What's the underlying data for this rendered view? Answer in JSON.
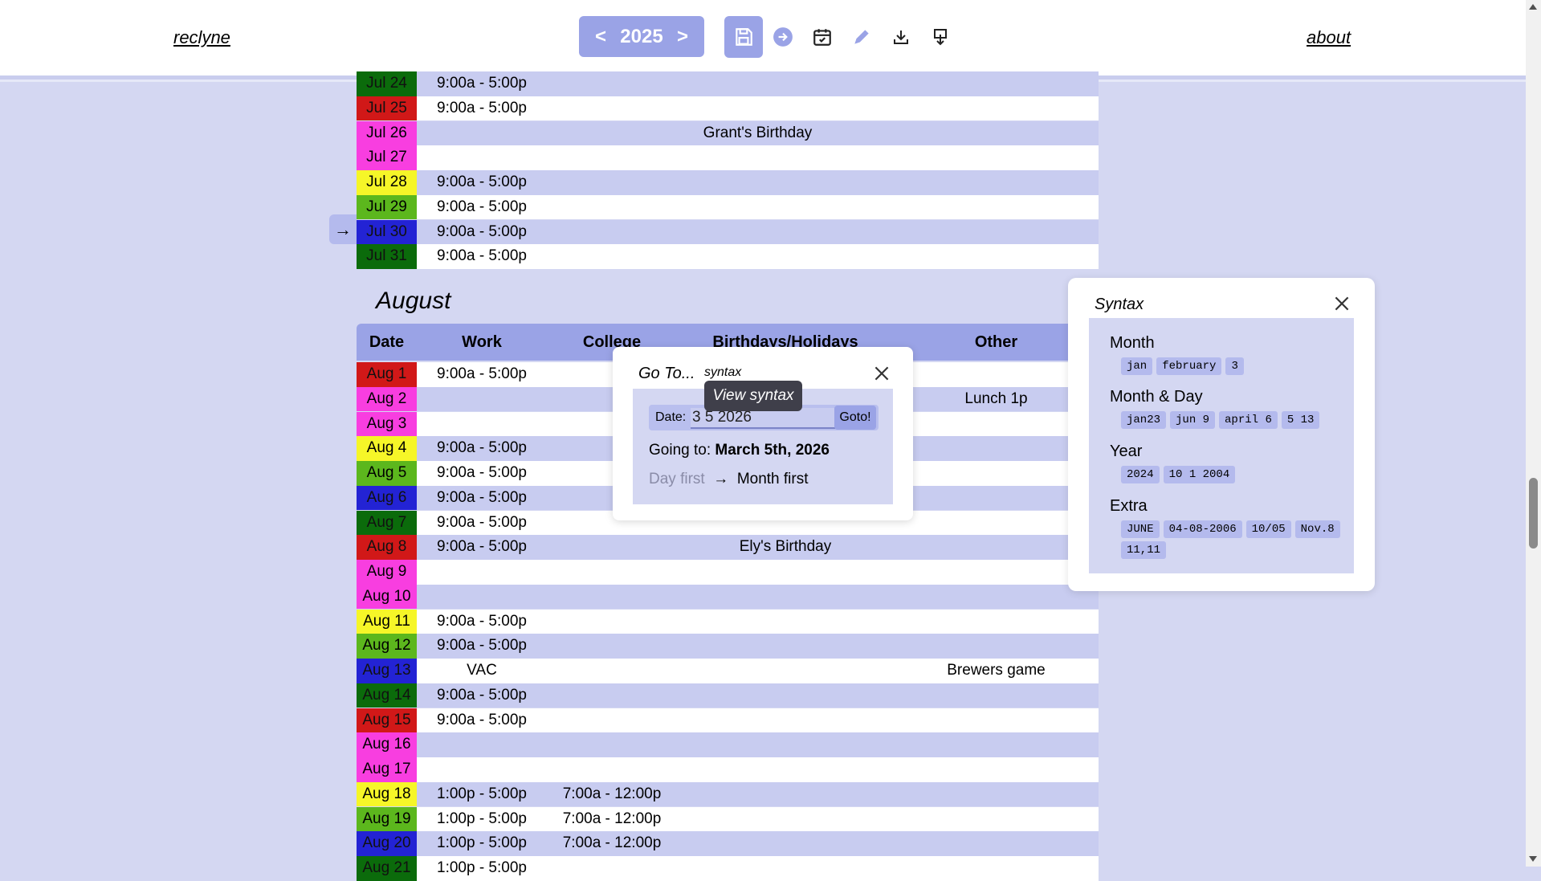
{
  "header": {
    "brand": "reclyne",
    "year": "2025",
    "prev_label": "<",
    "next_label": ">",
    "about": "about",
    "toolbar_icons": [
      "save-icon",
      "goto-icon",
      "calendar-check-icon",
      "pencil-icon",
      "download-icon",
      "export-icon"
    ]
  },
  "july_rows": [
    {
      "date": "Jul 24",
      "color": "#0b6b0b",
      "work": "9:00a - 5:00p",
      "college": "",
      "bday": "",
      "other": ""
    },
    {
      "date": "Jul 25",
      "color": "#d11818",
      "work": "9:00a - 5:00p",
      "college": "",
      "bday": "",
      "other": ""
    },
    {
      "date": "Jul 26",
      "color": "#f83ee0",
      "work": "",
      "college": "",
      "bday": "Grant's Birthday",
      "other": ""
    },
    {
      "date": "Jul 27",
      "color": "#f83ee0",
      "work": "",
      "college": "",
      "bday": "",
      "other": ""
    },
    {
      "date": "Jul 28",
      "color": "#f6f628",
      "work": "9:00a - 5:00p",
      "college": "",
      "bday": "",
      "other": ""
    },
    {
      "date": "Jul 29",
      "color": "#5cb71d",
      "work": "9:00a - 5:00p",
      "college": "",
      "bday": "",
      "other": ""
    },
    {
      "date": "Jul 30",
      "color": "#2323d4",
      "work": "9:00a - 5:00p",
      "college": "",
      "bday": "",
      "other": ""
    },
    {
      "date": "Jul 31",
      "color": "#0b6b0b",
      "work": "9:00a - 5:00p",
      "college": "",
      "bday": "",
      "other": ""
    }
  ],
  "today_arrow": "→",
  "month_title": "August",
  "columns": [
    "Date",
    "Work",
    "College",
    "Birthdays/Holidays",
    "Other"
  ],
  "august_rows": [
    {
      "date": "Aug 1",
      "color": "#d11818",
      "work": "9:00a - 5:00p",
      "college": "",
      "bday": "",
      "other": ""
    },
    {
      "date": "Aug 2",
      "color": "#f83ee0",
      "work": "",
      "college": "",
      "bday": "",
      "other": "Lunch 1p"
    },
    {
      "date": "Aug 3",
      "color": "#f83ee0",
      "work": "",
      "college": "",
      "bday": "",
      "other": ""
    },
    {
      "date": "Aug 4",
      "color": "#f6f628",
      "work": "9:00a - 5:00p",
      "college": "",
      "bday": "",
      "other": ""
    },
    {
      "date": "Aug 5",
      "color": "#5cb71d",
      "work": "9:00a - 5:00p",
      "college": "",
      "bday": "",
      "other": ""
    },
    {
      "date": "Aug 6",
      "color": "#2323d4",
      "work": "9:00a - 5:00p",
      "college": "",
      "bday": "",
      "other": ""
    },
    {
      "date": "Aug 7",
      "color": "#0b6b0b",
      "work": "9:00a - 5:00p",
      "college": "",
      "bday": "",
      "other": ""
    },
    {
      "date": "Aug 8",
      "color": "#d11818",
      "work": "9:00a - 5:00p",
      "college": "",
      "bday": "Ely's Birthday",
      "other": ""
    },
    {
      "date": "Aug 9",
      "color": "#f83ee0",
      "work": "",
      "college": "",
      "bday": "",
      "other": ""
    },
    {
      "date": "Aug 10",
      "color": "#f83ee0",
      "work": "",
      "college": "",
      "bday": "",
      "other": ""
    },
    {
      "date": "Aug 11",
      "color": "#f6f628",
      "work": "9:00a - 5:00p",
      "college": "",
      "bday": "",
      "other": ""
    },
    {
      "date": "Aug 12",
      "color": "#5cb71d",
      "work": "9:00a - 5:00p",
      "college": "",
      "bday": "",
      "other": ""
    },
    {
      "date": "Aug 13",
      "color": "#2323d4",
      "work": "VAC",
      "college": "",
      "bday": "",
      "other": "Brewers game"
    },
    {
      "date": "Aug 14",
      "color": "#0b6b0b",
      "work": "9:00a - 5:00p",
      "college": "",
      "bday": "",
      "other": ""
    },
    {
      "date": "Aug 15",
      "color": "#d11818",
      "work": "9:00a - 5:00p",
      "college": "",
      "bday": "",
      "other": ""
    },
    {
      "date": "Aug 16",
      "color": "#f83ee0",
      "work": "",
      "college": "",
      "bday": "",
      "other": ""
    },
    {
      "date": "Aug 17",
      "color": "#f83ee0",
      "work": "",
      "college": "",
      "bday": "",
      "other": ""
    },
    {
      "date": "Aug 18",
      "color": "#f6f628",
      "work": "1:00p - 5:00p",
      "college": "7:00a - 12:00p",
      "bday": "",
      "other": ""
    },
    {
      "date": "Aug 19",
      "color": "#5cb71d",
      "work": "1:00p - 5:00p",
      "college": "7:00a - 12:00p",
      "bday": "",
      "other": ""
    },
    {
      "date": "Aug 20",
      "color": "#2323d4",
      "work": "1:00p - 5:00p",
      "college": "7:00a - 12:00p",
      "bday": "",
      "other": ""
    },
    {
      "date": "Aug 21",
      "color": "#0b6b0b",
      "work": "1:00p - 5:00p",
      "college": "",
      "bday": "",
      "other": ""
    }
  ],
  "goto": {
    "title": "Go To...",
    "syntax_link": "syntax",
    "tooltip": "View syntax",
    "date_label": "Date:",
    "date_value": "3 5 2026",
    "go_button": "Goto!",
    "going_prefix": "Going to: ",
    "going_value": "March 5th, 2026",
    "day_first": "Day first",
    "arrow": "→",
    "month_first": "Month first"
  },
  "syntax": {
    "title": "Syntax",
    "groups": [
      {
        "heading": "Month",
        "examples": [
          "jan",
          "february",
          "3"
        ]
      },
      {
        "heading": "Month & Day",
        "examples": [
          "jan23",
          "jun 9",
          "april 6",
          "5 13"
        ]
      },
      {
        "heading": "Year",
        "examples": [
          "2024",
          "10 1 2004"
        ]
      },
      {
        "heading": "Extra",
        "examples": [
          "JUNE",
          "04-08-2006",
          "10/05",
          "Nov.8",
          "11,11"
        ]
      }
    ]
  }
}
